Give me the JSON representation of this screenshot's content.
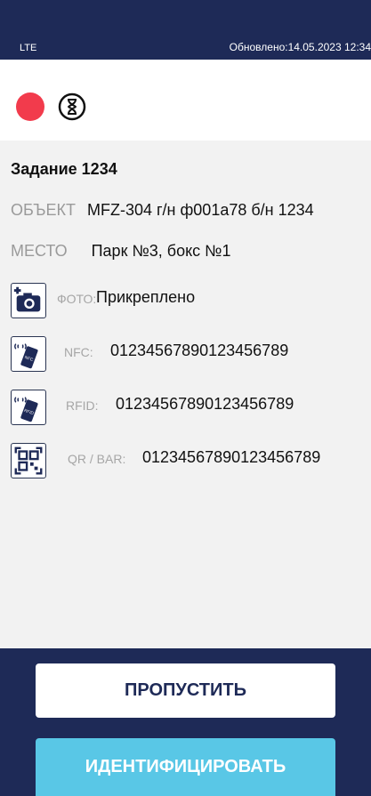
{
  "status_bar": {
    "network": "LTE",
    "updated": "Обновлено:14.05.2023 12:34"
  },
  "task": {
    "title": "Задание 1234",
    "object_label": "ОБЪЕКТ",
    "object_value": "MFZ-304 г/н ф001а78 б/н 1234",
    "place_label": "МЕСТО",
    "place_value": "Парк №3, бокс №1"
  },
  "identifiers": [
    {
      "label": "ФОТО:",
      "value": "Прикреплено",
      "icon": "camera-add-icon"
    },
    {
      "label": "NFC:",
      "value": "01234567890123456789",
      "icon": "nfc-icon"
    },
    {
      "label": "RFID:",
      "value": "01234567890123456789",
      "icon": "rfid-icon"
    },
    {
      "label": "QR / BAR:",
      "value": "01234567890123456789",
      "icon": "qr-code-icon"
    }
  ],
  "icons": {
    "status_dot": "red-status-dot",
    "timer": "hourglass-icon"
  },
  "colors": {
    "header_bg": "#1e2a57",
    "status_red": "#f23b4c",
    "identify_button": "#59c7e6",
    "content_bg": "#f2f2f2"
  },
  "buttons": {
    "skip": "ПРОПУСТИТЬ",
    "identify": "ИДЕНТИФИЦИРОВАТЬ"
  }
}
